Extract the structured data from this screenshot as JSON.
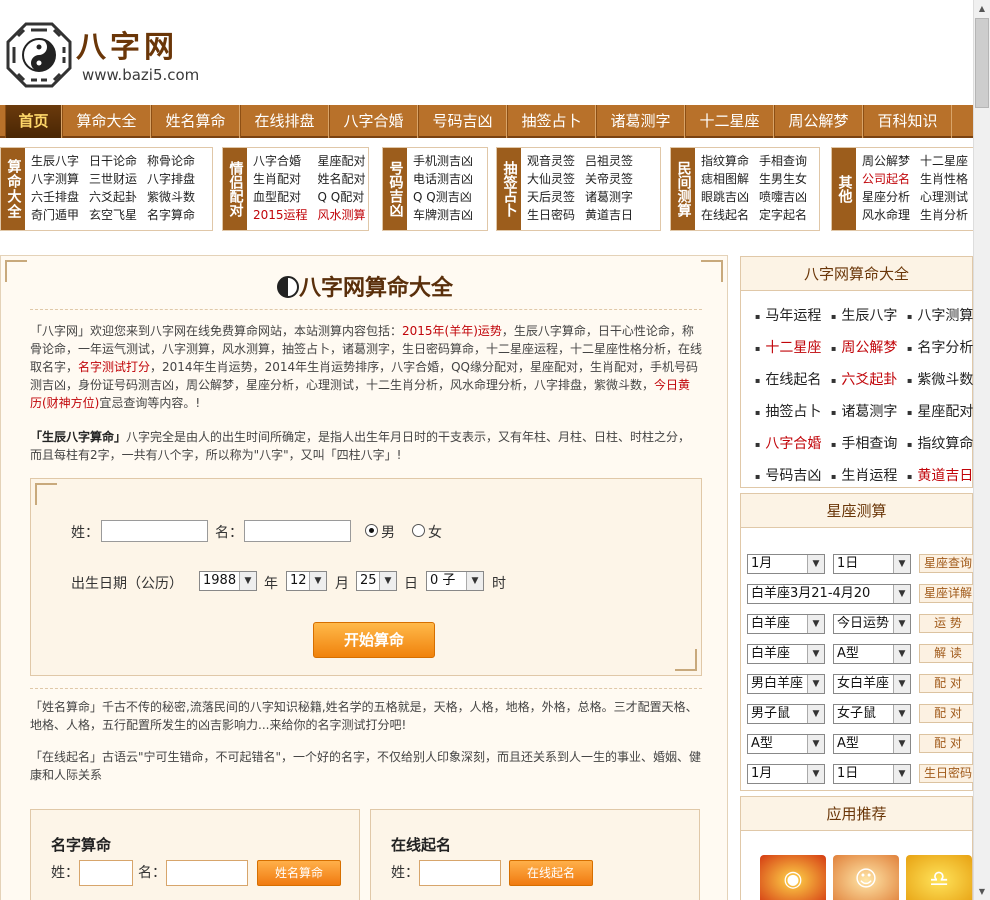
{
  "header": {
    "logo_text": "八字网",
    "logo_url": "www.bazi5.com"
  },
  "nav": [
    "首页",
    "算命大全",
    "姓名算命",
    "在线排盘",
    "八字合婚",
    "号码吉凶",
    "抽签占卜",
    "诸葛测字",
    "十二星座",
    "周公解梦",
    "百科知识"
  ],
  "categories": [
    {
      "title": "算命大全",
      "links": [
        "生辰八字",
        "八字测算",
        "六壬排盘",
        "奇门遁甲",
        "日干论命",
        "三世财运",
        "六爻起卦",
        "玄空飞星",
        "称骨论命",
        "八字排盘",
        "紫微斗数",
        "名字算命"
      ]
    },
    {
      "title": "情侣配对",
      "links": [
        "八字合婚",
        "生肖配对",
        "血型配对",
        "2015运程",
        "星座配对",
        "姓名配对",
        "Q Q配对",
        "风水测算"
      ]
    },
    {
      "title": "号码吉凶",
      "links": [
        "手机测吉凶",
        "电话测吉凶",
        "Q Q测吉凶",
        "车牌测吉凶"
      ]
    },
    {
      "title": "抽签占卜",
      "links": [
        "观音灵签",
        "大仙灵签",
        "天后灵签",
        "生日密码",
        "吕祖灵签",
        "关帝灵签",
        "诸葛测字",
        "黄道吉日"
      ]
    },
    {
      "title": "民间测算",
      "links": [
        "指纹算命",
        "痣相图解",
        "眼跳吉凶",
        "在线起名",
        "手相查询",
        "生男生女",
        "喷嚏吉凶",
        "定字起名"
      ]
    },
    {
      "title": "其他",
      "links": [
        "周公解梦",
        "公司起名",
        "星座分析",
        "风水命理",
        "十二星座",
        "生肖性格",
        "心理测试",
        "生肖分析"
      ]
    }
  ],
  "main": {
    "title": "八字网算命大全",
    "intro": {
      "p1a": "「八字网」欢迎您来到八字网在线免费算命网站，本站测算内容包括：",
      "p1b": "2015年(羊年)运势",
      "p1c": "，生辰八字算命，日干心性论命，称骨论命，一年运气测试，八字测算，风水测算，抽签占卜，诸葛测字，生日密码算命，十二星座运程，十二星座性格分析，在线取名字，",
      "p1d": "名字测试打分",
      "p1e": "，2014年生肖运势，2014年生肖运势排序，八字合婚，QQ缘分配对，星座配对，生肖配对，手机号码测吉凶，身份证号码测吉凶，周公解梦，星座分析，心理测试，十二生肖分析，风水命理分析，八字排盘，紫微斗数，",
      "p1f": "今日黄历(财神方位)",
      "p1g": "宜忌查询等内容。!",
      "p2a": "「生辰八字算命」",
      "p2b": "八字完全是由人的出生时间所确定，是指人出生年月日时的干支表示，又有年柱、月柱、日柱、时柱之分，而且每柱有2字，一共有八个字，所以称为\"八字\"，又叫「四柱八字」!"
    },
    "form": {
      "surname_label": "姓：",
      "name_label": "名：",
      "male": "男",
      "female": "女",
      "birth_label": "出生日期（公历）",
      "year": "1988",
      "year_unit": "年",
      "month": "12",
      "month_unit": "月",
      "day": "25",
      "day_unit": "日",
      "hour": "0 子",
      "hour_unit": "时",
      "start_button": "开始算命"
    },
    "para3": "「姓名算命」千古不传的秘密,流落民间的八字知识秘籍,姓名学的五格就是，天格，人格，地格，外格，总格。三才配置天格、地格、人格，五行配置所发生的凶吉影响力...来给你的名字测试打分吧!",
    "para4": "「在线起名」古语云\"宁可生错命，不可起错名\"，一个好的名字，不仅给别人印象深刻，而且还关系到人一生的事业、婚姻、健康和人际关系",
    "name_box": {
      "title": "名字算命",
      "surname_label": "姓：",
      "name_label": "名：",
      "button": "姓名算命"
    },
    "qiming_box": {
      "title": "在线起名",
      "surname_label": "姓：",
      "button": "在线起名"
    }
  },
  "sidebar": {
    "box1_title": "八字网算命大全",
    "links": [
      "马年运程",
      "生辰八字",
      "八字测算",
      "十二星座",
      "周公解梦",
      "名字分析",
      "在线起名",
      "六爻起卦",
      "紫微斗数",
      "抽签占卜",
      "诸葛测字",
      "星座配对",
      "八字合婚",
      "手相查询",
      "指纹算命",
      "号码吉凶",
      "生肖运程",
      "黄道吉日"
    ],
    "red_links": [
      3,
      4,
      7,
      12,
      17
    ],
    "box2_title": "星座测算",
    "rows": [
      {
        "a": "1月",
        "b": "1日",
        "btn": "星座查询"
      },
      {
        "a": "白羊座3月21-4月20",
        "b": "",
        "btn": "星座详解"
      },
      {
        "a": "白羊座",
        "b": "今日运势",
        "btn": "运 势"
      },
      {
        "a": "白羊座",
        "b": "A型",
        "btn": "解 读"
      },
      {
        "a": "男白羊座",
        "b": "女白羊座",
        "btn": "配 对"
      },
      {
        "a": "男子鼠",
        "b": "女子鼠",
        "btn": "配 对"
      },
      {
        "a": "A型",
        "b": "A型",
        "btn": "配 对"
      },
      {
        "a": "1月",
        "b": "1日",
        "btn": "生日密码"
      }
    ],
    "box3_title": "应用推荐"
  },
  "colors": {
    "nav": "#b8712a",
    "nav_active": "#4a2604",
    "accent_red": "#c1050a",
    "orange_button": "#f0820c"
  }
}
